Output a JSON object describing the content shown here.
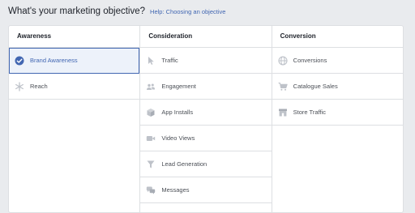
{
  "header": {
    "title": "What's your marketing objective?",
    "help_link": "Help: Choosing an objective"
  },
  "columns": [
    {
      "title": "Awareness",
      "items": [
        {
          "label": "Brand Awareness",
          "icon": "check-circle-icon",
          "selected": true
        },
        {
          "label": "Reach",
          "icon": "asterisk-icon",
          "selected": false
        }
      ]
    },
    {
      "title": "Consideration",
      "items": [
        {
          "label": "Traffic",
          "icon": "cursor-icon",
          "selected": false
        },
        {
          "label": "Engagement",
          "icon": "people-icon",
          "selected": false
        },
        {
          "label": "App Installs",
          "icon": "cube-icon",
          "selected": false
        },
        {
          "label": "Video Views",
          "icon": "video-camera-icon",
          "selected": false
        },
        {
          "label": "Lead Generation",
          "icon": "funnel-icon",
          "selected": false
        },
        {
          "label": "Messages",
          "icon": "chat-bubbles-icon",
          "selected": false
        }
      ]
    },
    {
      "title": "Conversion",
      "items": [
        {
          "label": "Conversions",
          "icon": "globe-icon",
          "selected": false
        },
        {
          "label": "Catalogue Sales",
          "icon": "shopping-cart-icon",
          "selected": false
        },
        {
          "label": "Store Traffic",
          "icon": "store-icon",
          "selected": false
        }
      ]
    }
  ],
  "colors": {
    "accent": "#4267b2",
    "selected_bg": "#edf2fa",
    "icon_gray": "#bec2c9",
    "border": "#dddfe2",
    "page_bg": "#e9ebee"
  }
}
